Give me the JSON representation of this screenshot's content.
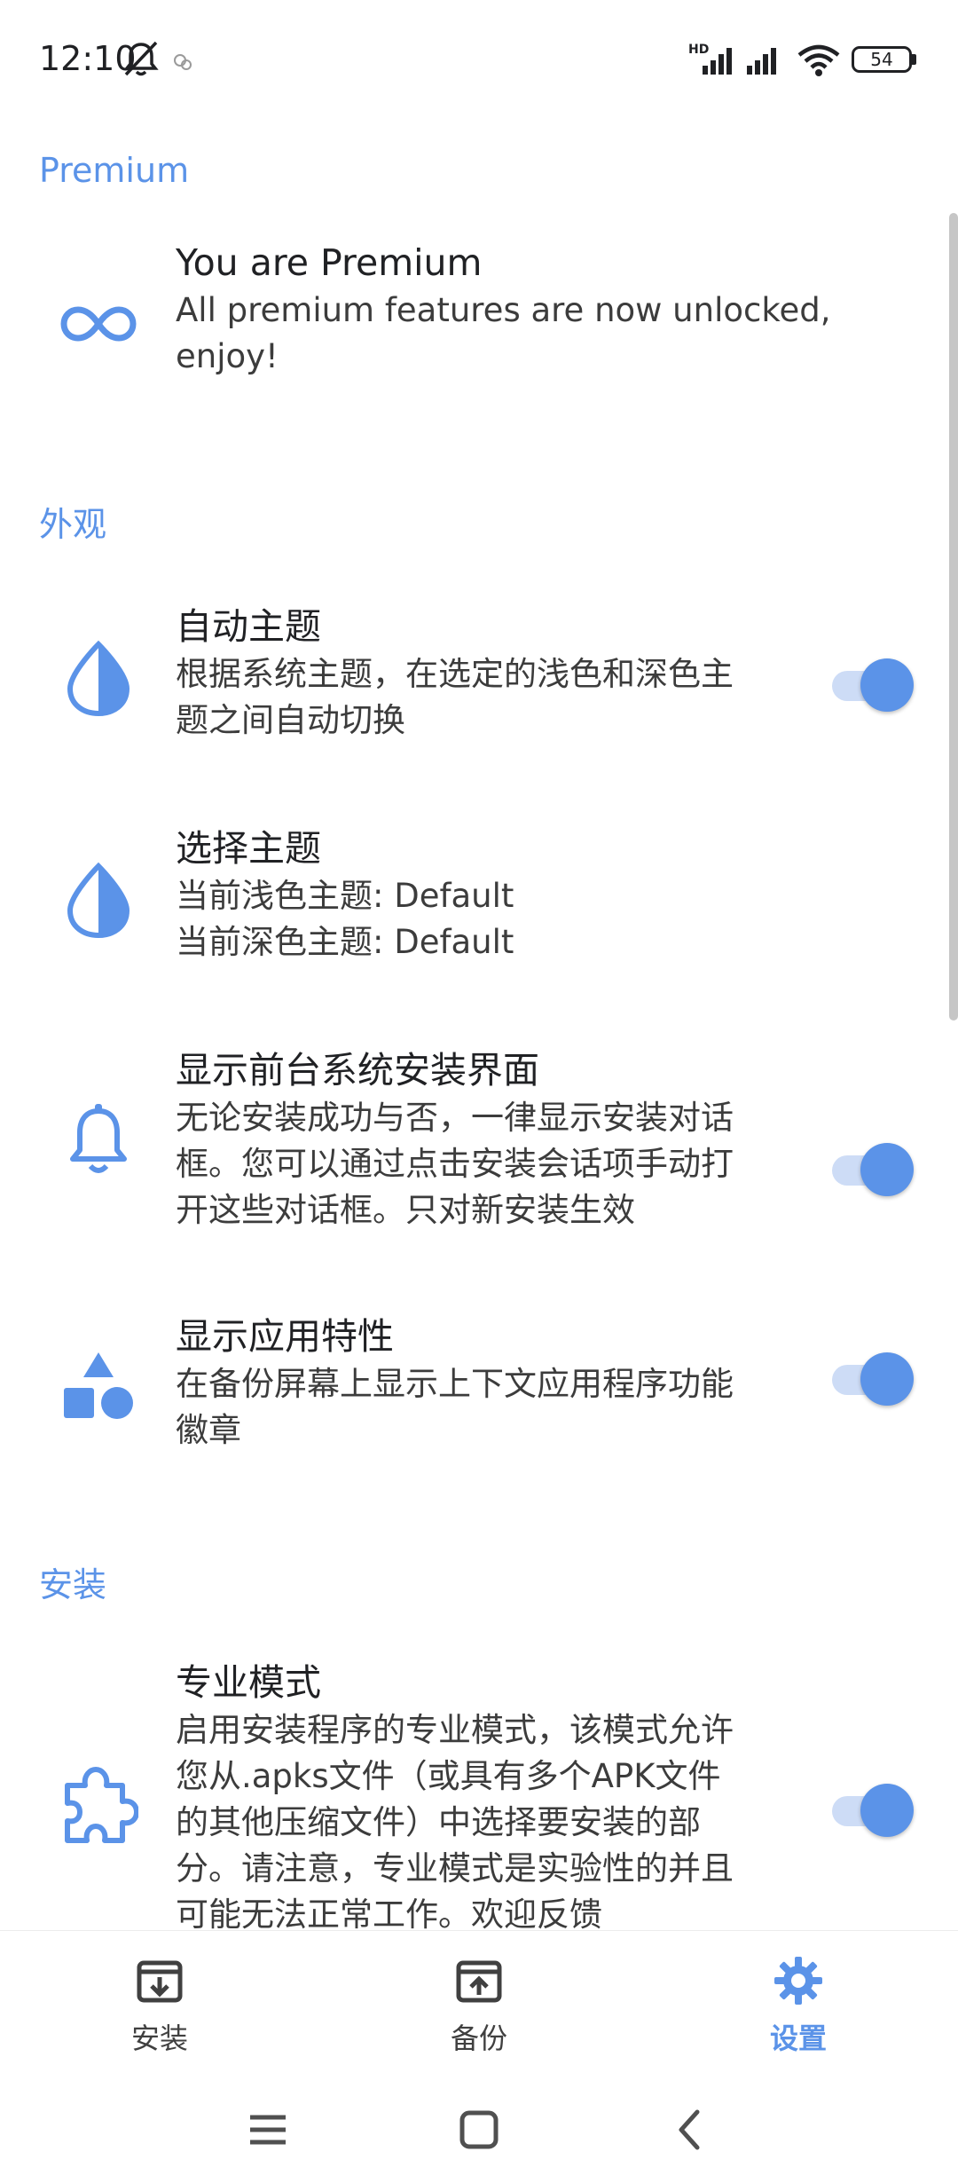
{
  "status_bar": {
    "time": "12:10",
    "network_badge": "HD",
    "battery": "54"
  },
  "sections": {
    "premium": {
      "title": "Premium",
      "item": {
        "title": "You are Premium",
        "desc_lines": [
          "All premium features are now unlocked,",
          "enjoy!"
        ]
      }
    },
    "appearance": {
      "title": "外观",
      "items": [
        {
          "title": "自动主题",
          "desc_lines": [
            "根据系统主题，在选定的浅色和深色主",
            "题之间自动切换"
          ],
          "toggle": true
        },
        {
          "title": "选择主题",
          "desc_lines": [
            "当前浅色主题: Default",
            "当前深色主题: Default"
          ]
        },
        {
          "title": "显示前台系统安装界面",
          "desc_lines": [
            "无论安装成功与否，一律显示安装对话",
            "框。您可以通过点击安装会话项手动打",
            "开这些对话框。只对新安装生效"
          ],
          "toggle": true
        },
        {
          "title": "显示应用特性",
          "desc_lines": [
            "在备份屏幕上显示上下文应用程序功能",
            "徽章"
          ],
          "toggle": true
        }
      ]
    },
    "install": {
      "title": "安装",
      "items": [
        {
          "title": "专业模式",
          "desc_lines": [
            "启用安装程序的专业模式，该模式允许",
            "您从.apks文件（或具有多个APK文件",
            "的其他压缩文件）中选择要安装的部",
            "分。请注意，专业模式是实验性的并且",
            "可能无法正常工作。欢迎反馈"
          ],
          "toggle": true
        }
      ]
    }
  },
  "bottom_nav": [
    {
      "label": "安装",
      "icon": "install-icon",
      "active": false
    },
    {
      "label": "备份",
      "icon": "backup-icon",
      "active": false
    },
    {
      "label": "设置",
      "icon": "settings-gear-icon",
      "active": true
    }
  ],
  "colors": {
    "accent": "#5b93e8",
    "toggle_track": "#cddcf6"
  }
}
